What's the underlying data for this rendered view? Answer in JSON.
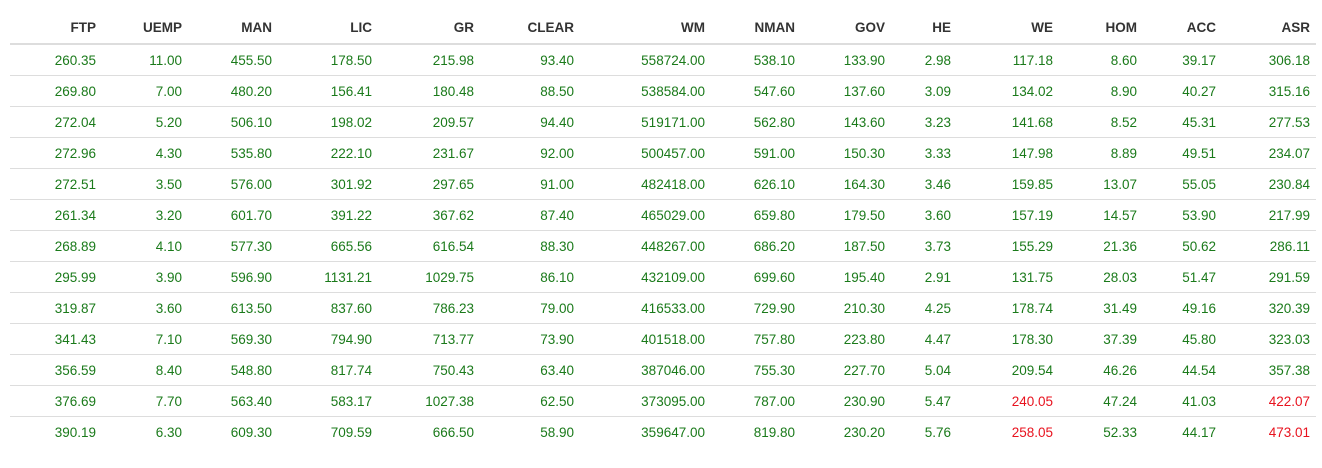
{
  "colors": {
    "positive": "#1a7a1a",
    "negative": "#e8121e",
    "header": "#333333",
    "border": "#dddddd"
  },
  "table": {
    "columns": [
      "FTP",
      "UEMP",
      "MAN",
      "LIC",
      "GR",
      "CLEAR",
      "WM",
      "NMAN",
      "GOV",
      "HE",
      "WE",
      "HOM",
      "ACC",
      "ASR"
    ],
    "rows": [
      [
        "260.35",
        "11.00",
        "455.50",
        "178.50",
        "215.98",
        "93.40",
        "558724.00",
        "538.10",
        "133.90",
        "2.98",
        "117.18",
        "8.60",
        "39.17",
        "306.18"
      ],
      [
        "269.80",
        "7.00",
        "480.20",
        "156.41",
        "180.48",
        "88.50",
        "538584.00",
        "547.60",
        "137.60",
        "3.09",
        "134.02",
        "8.90",
        "40.27",
        "315.16"
      ],
      [
        "272.04",
        "5.20",
        "506.10",
        "198.02",
        "209.57",
        "94.40",
        "519171.00",
        "562.80",
        "143.60",
        "3.23",
        "141.68",
        "8.52",
        "45.31",
        "277.53"
      ],
      [
        "272.96",
        "4.30",
        "535.80",
        "222.10",
        "231.67",
        "92.00",
        "500457.00",
        "591.00",
        "150.30",
        "3.33",
        "147.98",
        "8.89",
        "49.51",
        "234.07"
      ],
      [
        "272.51",
        "3.50",
        "576.00",
        "301.92",
        "297.65",
        "91.00",
        "482418.00",
        "626.10",
        "164.30",
        "3.46",
        "159.85",
        "13.07",
        "55.05",
        "230.84"
      ],
      [
        "261.34",
        "3.20",
        "601.70",
        "391.22",
        "367.62",
        "87.40",
        "465029.00",
        "659.80",
        "179.50",
        "3.60",
        "157.19",
        "14.57",
        "53.90",
        "217.99"
      ],
      [
        "268.89",
        "4.10",
        "577.30",
        "665.56",
        "616.54",
        "88.30",
        "448267.00",
        "686.20",
        "187.50",
        "3.73",
        "155.29",
        "21.36",
        "50.62",
        "286.11"
      ],
      [
        "295.99",
        "3.90",
        "596.90",
        "1131.21",
        "1029.75",
        "86.10",
        "432109.00",
        "699.60",
        "195.40",
        "2.91",
        "131.75",
        "28.03",
        "51.47",
        "291.59"
      ],
      [
        "319.87",
        "3.60",
        "613.50",
        "837.60",
        "786.23",
        "79.00",
        "416533.00",
        "729.90",
        "210.30",
        "4.25",
        "178.74",
        "31.49",
        "49.16",
        "320.39"
      ],
      [
        "341.43",
        "7.10",
        "569.30",
        "794.90",
        "713.77",
        "73.90",
        "401518.00",
        "757.80",
        "223.80",
        "4.47",
        "178.30",
        "37.39",
        "45.80",
        "323.03"
      ],
      [
        "356.59",
        "8.40",
        "548.80",
        "817.74",
        "750.43",
        "63.40",
        "387046.00",
        "755.30",
        "227.70",
        "5.04",
        "209.54",
        "46.26",
        "44.54",
        "357.38"
      ],
      [
        "376.69",
        "7.70",
        "563.40",
        "583.17",
        "1027.38",
        "62.50",
        "373095.00",
        "787.00",
        "230.90",
        "5.47",
        "240.05",
        "47.24",
        "41.03",
        "422.07"
      ],
      [
        "390.19",
        "6.30",
        "609.30",
        "709.59",
        "666.50",
        "58.90",
        "359647.00",
        "819.80",
        "230.20",
        "5.76",
        "258.05",
        "52.33",
        "44.17",
        "473.01"
      ]
    ],
    "highlighted": [
      {
        "row": 11,
        "col": 10
      },
      {
        "row": 11,
        "col": 13
      },
      {
        "row": 12,
        "col": 10
      },
      {
        "row": 12,
        "col": 13
      }
    ]
  }
}
